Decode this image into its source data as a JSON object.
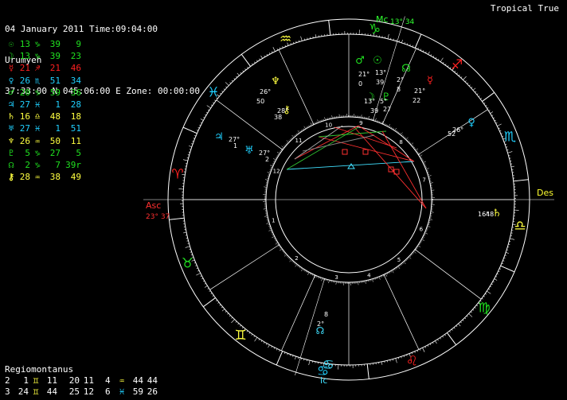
{
  "header": {
    "line1": "04 January 2011 Time:09:04:00",
    "line2": "Urumyeh",
    "line3": "37:33:00 N 045:06:00 E Zone: 00:00:00",
    "system": "Tropical True"
  },
  "colors": {
    "fire": "#ff2020",
    "earth": "#20e020",
    "air": "#ffff40",
    "water": "#20d0ff",
    "white": "#ffffff",
    "angle_red": "#ff3030",
    "angle_green": "#30ff30",
    "angle_yellow": "#ffff30",
    "angle_cyan": "#40e0ff"
  },
  "planets": [
    {
      "glyph": "☉",
      "name": "sun",
      "deg": "13",
      "sign": "♑",
      "min": "39",
      "sec": "9",
      "color": "#20e020"
    },
    {
      "glyph": "☽",
      "name": "moon",
      "deg": "13",
      "sign": "♑",
      "min": "39",
      "sec": "23",
      "color": "#20e020"
    },
    {
      "glyph": "☿",
      "name": "mercury",
      "deg": "21",
      "sign": "♐",
      "min": "21",
      "sec": "46",
      "color": "#ff2020"
    },
    {
      "glyph": "♀",
      "name": "venus",
      "deg": "26",
      "sign": "♏",
      "min": "51",
      "sec": "34",
      "color": "#20d0ff"
    },
    {
      "glyph": "♂",
      "name": "mars",
      "deg": "20",
      "sign": "♑",
      "min": "59",
      "sec": "36",
      "color": "#20e020"
    },
    {
      "glyph": "♃",
      "name": "jupiter",
      "deg": "27",
      "sign": "♓",
      "min": "1",
      "sec": "28",
      "color": "#20d0ff"
    },
    {
      "glyph": "♄",
      "name": "saturn",
      "deg": "16",
      "sign": "♎",
      "min": "48",
      "sec": "18",
      "color": "#ffff40"
    },
    {
      "glyph": "♅",
      "name": "uranus",
      "deg": "27",
      "sign": "♓",
      "min": "1",
      "sec": "51",
      "color": "#20d0ff"
    },
    {
      "glyph": "♆",
      "name": "neptune",
      "deg": "26",
      "sign": "♒",
      "min": "50",
      "sec": "11",
      "color": "#ffff40"
    },
    {
      "glyph": "♇",
      "name": "pluto",
      "deg": "5",
      "sign": "♑",
      "min": "27",
      "sec": "5",
      "color": "#20e020"
    },
    {
      "glyph": "☊",
      "name": "node",
      "deg": "2",
      "sign": "♑",
      "min": "7",
      "sec": "39r",
      "color": "#20e020"
    },
    {
      "glyph": "⚷",
      "name": "chiron",
      "deg": "28",
      "sign": "♒",
      "min": "38",
      "sec": "49",
      "color": "#ffff40"
    }
  ],
  "houses": {
    "title": "Regiomontanus",
    "rows": [
      [
        {
          "n": "2",
          "deg": "1",
          "sign": "♊",
          "min": "11",
          "color": "#ffff40"
        },
        {
          "n": "",
          "deg": "20",
          "sign": "",
          "min": "11",
          "color": "#ffffff"
        },
        {
          "n": "4",
          "deg": "",
          "sign": "♒",
          "min": "44",
          "sec": "44",
          "color": "#ffff40"
        }
      ],
      [
        {
          "n": "3",
          "deg": "24",
          "sign": "♊",
          "min": "44",
          "color": "#ffff40"
        },
        {
          "n": "",
          "deg": "25",
          "sign": "",
          "min": "12",
          "color": "#ffffff"
        },
        {
          "n": "6",
          "deg": "",
          "sign": "♓",
          "min": "59",
          "sec": "26",
          "color": "#20d0ff"
        }
      ]
    ]
  },
  "angles": {
    "mc": {
      "label": "Mc",
      "deg": "13",
      "min": "34"
    },
    "asc": {
      "label": "Asc",
      "deg": "23",
      "min": "37"
    },
    "des": {
      "label": "Des"
    },
    "ic": {
      "label": "Ic"
    }
  },
  "wheel_signs": [
    {
      "glyph": "♒",
      "color": "#ffff40"
    },
    {
      "glyph": "♑",
      "color": "#20e020"
    },
    {
      "glyph": "♐",
      "color": "#ff2020"
    },
    {
      "glyph": "♏",
      "color": "#20d0ff"
    },
    {
      "glyph": "♎",
      "color": "#ffff40"
    },
    {
      "glyph": "♍",
      "color": "#20e020"
    },
    {
      "glyph": "♌",
      "color": "#ff2020"
    },
    {
      "glyph": "♋",
      "color": "#20d0ff"
    },
    {
      "glyph": "♊",
      "color": "#ffff40"
    },
    {
      "glyph": "♉",
      "color": "#20e020"
    },
    {
      "glyph": "♈",
      "color": "#ff2020"
    },
    {
      "glyph": "♓",
      "color": "#20d0ff"
    }
  ],
  "house_numbers": [
    "1",
    "2",
    "3",
    "4",
    "5",
    "6",
    "7",
    "8",
    "9",
    "10",
    "11",
    "12"
  ],
  "wheel_planets": [
    {
      "glyph": "♂",
      "deg": "21",
      "min": "0",
      "color": "#20e020"
    },
    {
      "glyph": "☉",
      "deg": "13",
      "min": "39",
      "color": "#20e020"
    },
    {
      "glyph": "☊",
      "deg": "2",
      "min": "8",
      "color": "#20e020"
    },
    {
      "glyph": "☿",
      "deg": "21",
      "min": "22",
      "color": "#ff2020"
    },
    {
      "glyph": "♀",
      "deg": "26",
      "min": "52",
      "color": "#20d0ff"
    },
    {
      "glyph": "♄",
      "deg": "16",
      "min": "48",
      "color": "#ffff40"
    },
    {
      "glyph": "♆",
      "deg": "26",
      "min": "50",
      "color": "#ffff40"
    },
    {
      "glyph": "⚷",
      "deg": "28",
      "min": "38",
      "color": "#ffff40"
    },
    {
      "glyph": "♃",
      "deg": "27",
      "min": "1",
      "color": "#20d0ff"
    },
    {
      "glyph": "♅",
      "deg": "27",
      "min": "2",
      "color": "#20d0ff"
    },
    {
      "glyph": "☽",
      "deg": "13",
      "min": "39",
      "color": "#20e020"
    },
    {
      "glyph": "♇",
      "deg": "5",
      "min": "27",
      "color": "#20e020"
    }
  ]
}
